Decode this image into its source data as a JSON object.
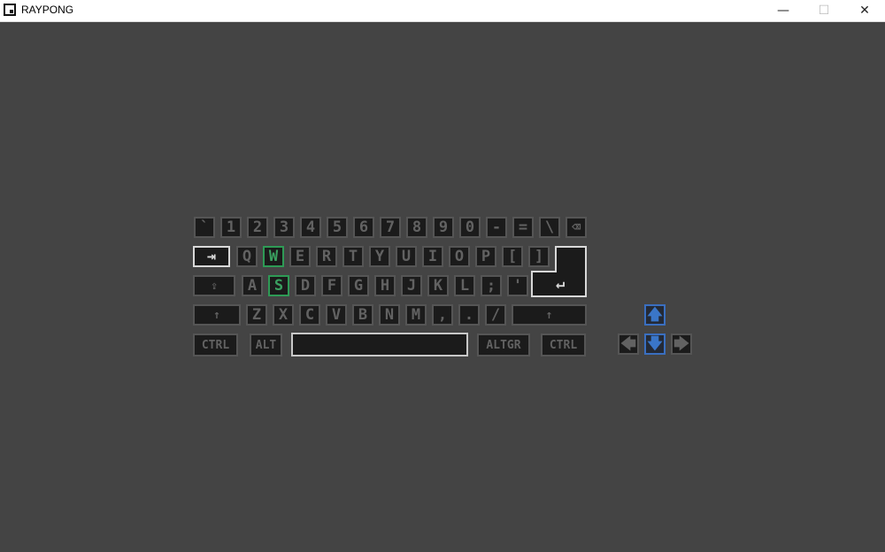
{
  "window": {
    "title": "RAYPONG",
    "minimize": "—",
    "maximize": "☐",
    "close": "✕"
  },
  "colors": {
    "background": "#444444",
    "key_face": "#1b1b1b",
    "key_border": "#555555",
    "pressed_player1": "#2e9a55",
    "pressed_player2": "#3a6fc0",
    "highlight": "#d8d8d8"
  },
  "keyboard": {
    "row1": [
      "`",
      "1",
      "2",
      "3",
      "4",
      "5",
      "6",
      "7",
      "8",
      "9",
      "0",
      "-",
      "=",
      "\\",
      "⌫"
    ],
    "row2": {
      "tab": "⇥",
      "keys": [
        "Q",
        "W",
        "E",
        "R",
        "T",
        "Y",
        "U",
        "I",
        "O",
        "P",
        "[",
        "]"
      ]
    },
    "row3": {
      "caps": "⇪",
      "keys": [
        "A",
        "S",
        "D",
        "F",
        "G",
        "H",
        "J",
        "K",
        "L",
        ";",
        "'"
      ],
      "enter": "↵"
    },
    "row4": {
      "shift_left": "↑",
      "keys": [
        "Z",
        "X",
        "C",
        "V",
        "B",
        "N",
        "M",
        ",",
        ".",
        "/"
      ],
      "shift_right": "↑"
    },
    "row5": {
      "ctrl_left": "CTRL",
      "alt": "ALT",
      "space": "",
      "altgr": "ALTGR",
      "ctrl_right": "CTRL"
    }
  },
  "arrows": {
    "up": "🡅",
    "left": "🡄",
    "down": "🡇",
    "right": "🡆"
  },
  "pressed": {
    "player1": [
      "W",
      "S"
    ],
    "player2": [
      "up",
      "down"
    ]
  }
}
